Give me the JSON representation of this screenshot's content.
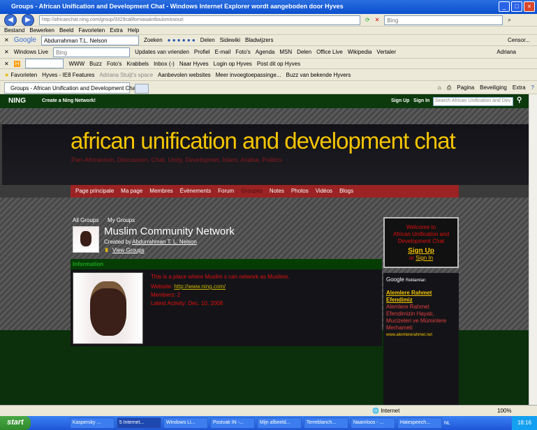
{
  "window": {
    "title": "Groups - African Unification and Development Chat - Windows Internet Explorer wordt aangeboden door Hyves"
  },
  "address": {
    "url": "http://africanchat.ning.com/group/3329californiasaintlouismissouri",
    "search_placeholder": "Bing"
  },
  "menu": [
    "Bestand",
    "Bewerken",
    "Beeld",
    "Favorieten",
    "Extra",
    "Help"
  ],
  "google_toolbar": {
    "logo": "Google",
    "query": "Abdurrahman T.L. Nelson",
    "search": "Zoeken",
    "share": "Delen",
    "sidewiki": "Sidewiki",
    "bookmarks": "Bladwijzers",
    "censor": "Censor..."
  },
  "live_toolbar": {
    "brand": "Windows Live",
    "placeholder": "Bing",
    "items": [
      "Updates van vrienden",
      "Profiel",
      "E-mail",
      "Foto's",
      "Agenda",
      "MSN",
      "Delen"
    ],
    "office": "Office Live",
    "wikipedia": "Wikipedia",
    "translator": "Vertaler",
    "user": "Adriana"
  },
  "hyves_toolbar": {
    "items": [
      "WWW",
      "Buzz",
      "Foto's",
      "Krabbels",
      "Inbox (-)",
      "Naar Hyves",
      "Login op Hyves",
      "Post dit op Hyves"
    ]
  },
  "favorites_bar": {
    "label": "Favorieten",
    "items": [
      "Hyves - IE8 Features",
      "Adriana Stuijt's space",
      "Aanbevolen websites",
      "Meer invoegtoepassinge...",
      "Buzz van bekende Hyvers"
    ]
  },
  "tab": {
    "title": "Groups - African Unification and Development Chat"
  },
  "command_bar": [
    "Pagina",
    "Beveiliging",
    "Extra"
  ],
  "ning": {
    "logo": "NING",
    "create": "Create a Ning Network!",
    "signup": "Sign Up",
    "signin": "Sign In",
    "search_placeholder": "Search African Unification and Dev"
  },
  "site": {
    "title": "african unification and development chat",
    "tagline": "Pan-Africanism, Discussion, Chat, Unity, Developmet, Islam, Arabia, Politics",
    "nav": [
      "Page principale",
      "Ma page",
      "Membres",
      "Évènements",
      "Forum",
      "Groupes",
      "Notes",
      "Photos",
      "Vidéos",
      "Blogs"
    ],
    "active_nav": "Groupes"
  },
  "group": {
    "all_groups": "All Groups",
    "my_groups": "My Groups",
    "name": "Muslim Community Network",
    "created_by": "Created by",
    "creator": "Abdurrahman T. L. Nelson",
    "view_groups": "View Groups",
    "info_header": "Information",
    "description": "This is a place where Muslim s can network as Muslims.",
    "website_label": "Website:",
    "website": "http://www.ning.com/",
    "members": "Members: 2",
    "latest": "Latest Activity: Dec. 10, 2008"
  },
  "welcome": {
    "line1": "Welcome to",
    "line2": "African Unification and",
    "line3": "Development Chat",
    "signup": "Sign Up",
    "or": "or",
    "signin": "Sign In"
  },
  "ads": {
    "google": "Google",
    "label": "Reklamları",
    "title1": "Alemlere Rahmet",
    "title2": "Efendimiz",
    "body": "Alemlere Rahmet Efendimizin Hayatı, Mucizeleri ve Müminlere Merhameti",
    "url": "www.alemlererahmet.net"
  },
  "status": {
    "zone": "Internet",
    "zoom": "100%"
  },
  "taskbar": {
    "start": "start",
    "tasks": [
      "Kaspersky ...",
      "5 Internet...",
      "Windows Li...",
      "Postvak IN -...",
      "Mijn afbeeld...",
      "Terreblanch...",
      "Naamloos - ...",
      "Hatespeech..."
    ],
    "lang": "NL",
    "time": "18:16"
  }
}
